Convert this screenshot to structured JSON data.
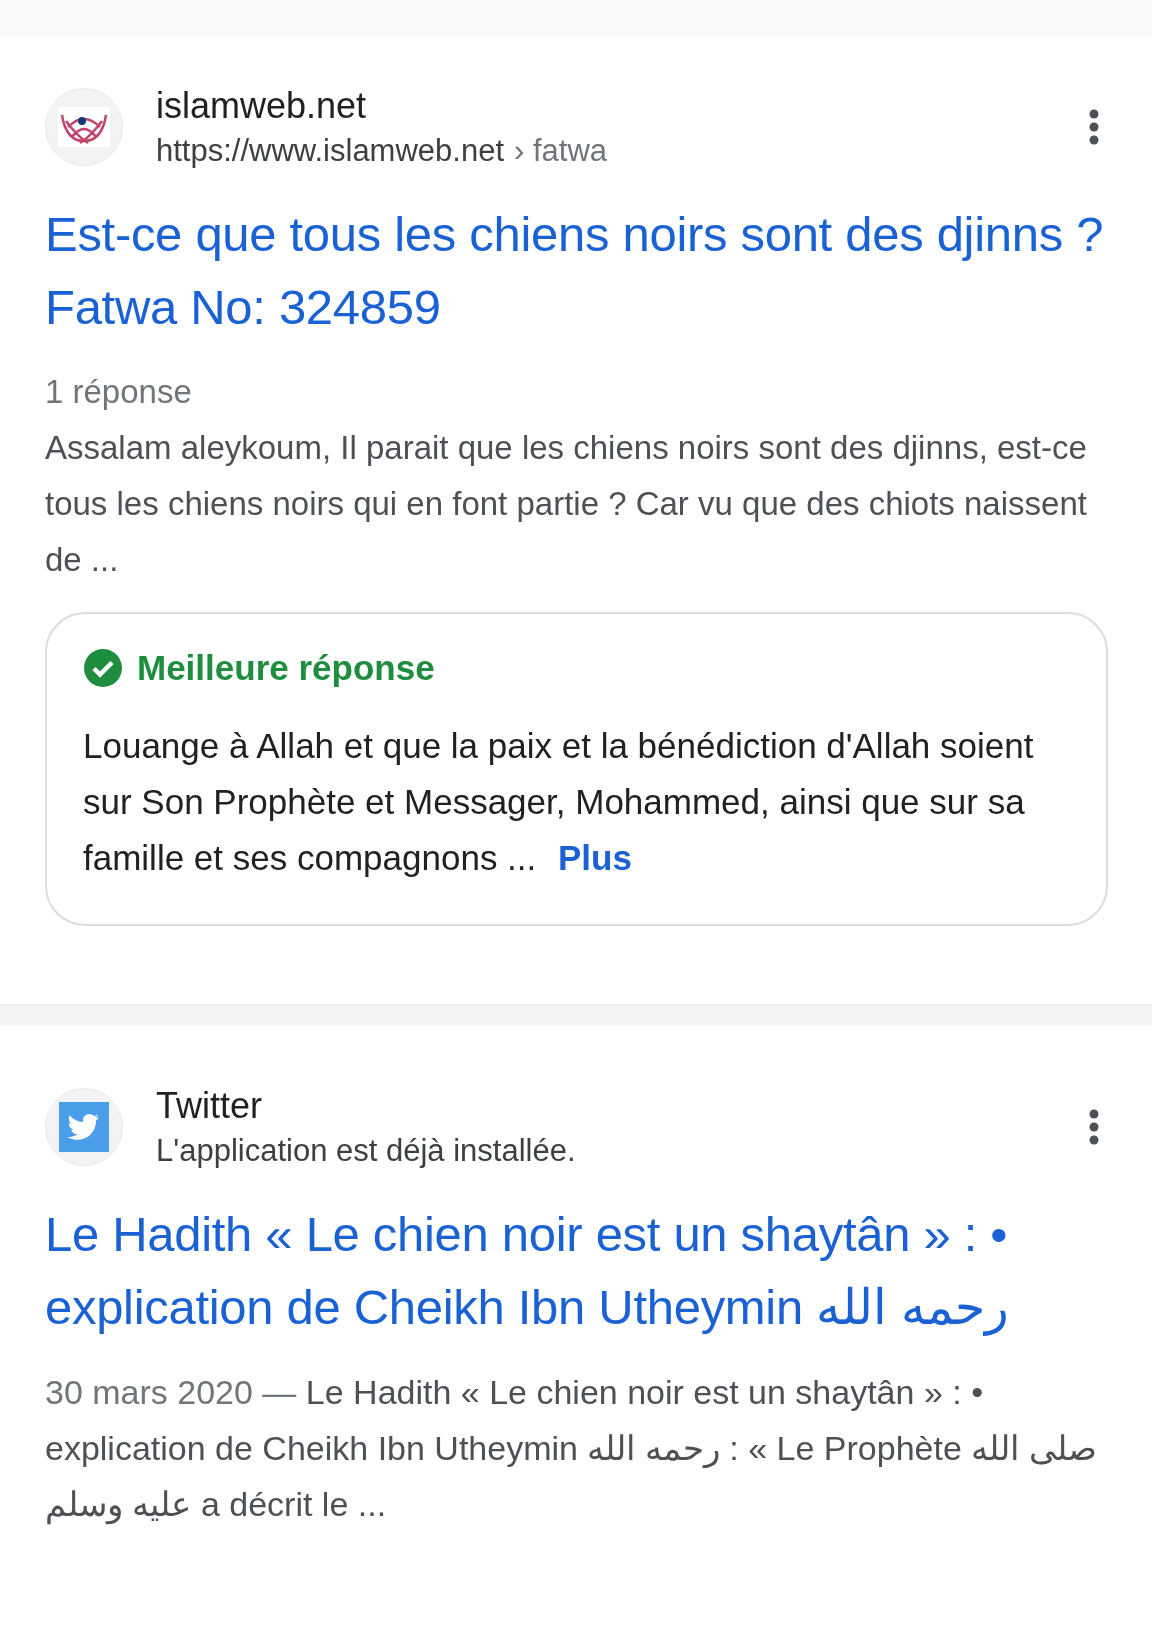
{
  "results": [
    {
      "site": "islamweb.net",
      "url": "https://www.islamweb.net",
      "path": "› fatwa",
      "kind": "islamweb",
      "title": "Est-ce que tous les chiens noirs sont des djinns ? Fatwa No: 324859",
      "answers": "1 réponse",
      "snippet": "Assalam aleykoum, Il parait que les chiens noirs sont des djinns, est-ce tous les chiens noirs qui en font partie ? Car vu que des chiots naissent de ...",
      "best_answer": {
        "label": "Meilleure réponse",
        "text": "Louange à Allah et que la paix et la bénédiction d'Allah soient sur Son Prophète et Messager, Mohammed, ainsi que sur sa famille et ses compagnons ...",
        "more": "Plus"
      }
    },
    {
      "site": "Twitter",
      "subtitle": "L'application est déjà installée.",
      "kind": "twitter",
      "title": "Le Hadith « Le chien noir est un shaytân » : • explication de Cheikh Ibn Utheymin رحمه الله",
      "date": "30 mars 2020 —",
      "snippet": "Le Hadith « Le chien noir est un shaytân » : • explication de Cheikh Ibn Utheymin رحمه الله : « Le Prophète صلى الله عليه وسلم a décrit le ..."
    }
  ]
}
